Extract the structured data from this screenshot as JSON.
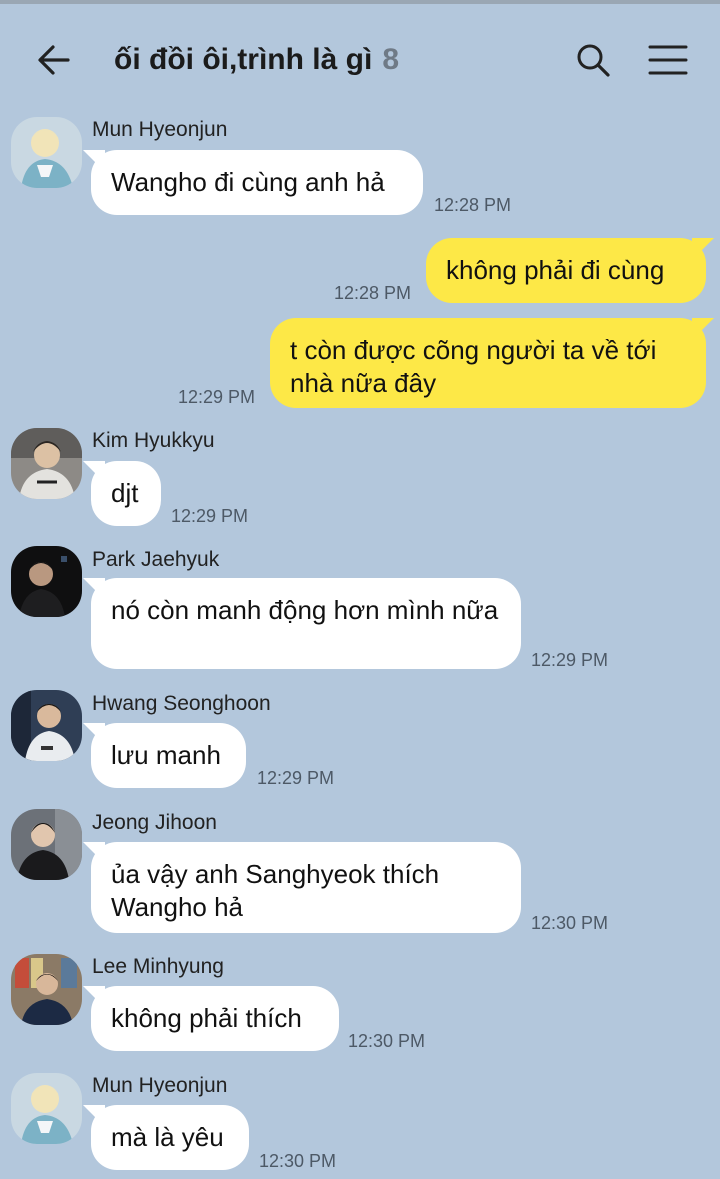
{
  "header": {
    "title": "ối đồi ôi,trình là gì",
    "member_count": "8",
    "back_icon": "arrow-left-icon",
    "search_icon": "search-icon",
    "menu_icon": "hamburger-menu-icon"
  },
  "colors": {
    "background": "#b3c7dc",
    "incoming_bubble": "#ffffff",
    "outgoing_bubble": "#fde847"
  },
  "messages": [
    {
      "sender": "Mun Hyeonjun",
      "text": "Wangho đi cùng anh hả",
      "time": "12:28 PM",
      "direction": "in"
    },
    {
      "text": "không phải đi cùng",
      "time": "12:28 PM",
      "direction": "out"
    },
    {
      "text": "t còn được cõng người ta về tới nhà nữa đây",
      "time": "12:29 PM",
      "direction": "out"
    },
    {
      "sender": "Kim Hyukkyu",
      "text": "djt",
      "time": "12:29 PM",
      "direction": "in"
    },
    {
      "sender": "Park Jaehyuk",
      "text": "nó còn manh động hơn mình nữa",
      "time": "12:29 PM",
      "direction": "in"
    },
    {
      "sender": "Hwang Seonghoon",
      "text": "lưu manh",
      "time": "12:29 PM",
      "direction": "in"
    },
    {
      "sender": "Jeong Jihoon",
      "text": "ủa vậy anh Sanghyeok thích Wangho hả",
      "time": "12:30 PM",
      "direction": "in"
    },
    {
      "sender": "Lee Minhyung",
      "text": "không phải thích",
      "time": "12:30 PM",
      "direction": "in"
    },
    {
      "sender": "Mun Hyeonjun",
      "text": "mà là yêu",
      "time": "12:30 PM",
      "direction": "in"
    }
  ]
}
